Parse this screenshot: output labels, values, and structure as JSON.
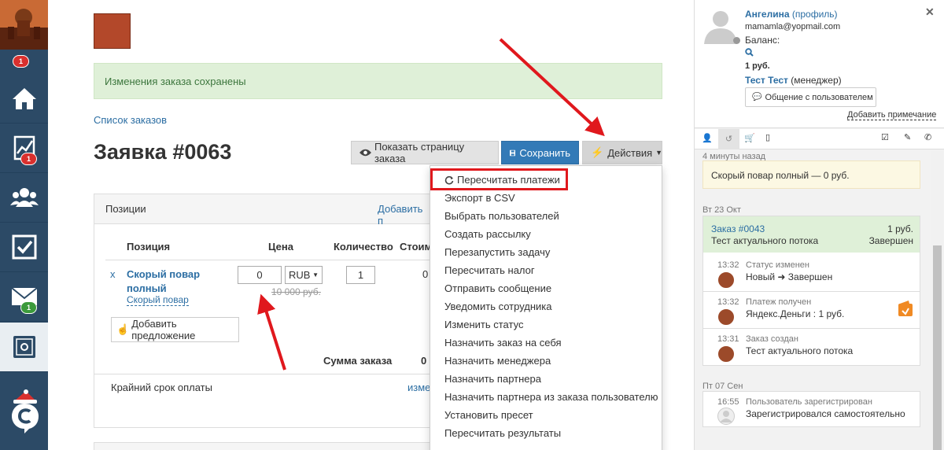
{
  "nav": {
    "orders_badge": "1",
    "stats_badge": "1",
    "mail_badge": "1"
  },
  "alert": {
    "message": "Изменения заказа сохранены"
  },
  "breadcrumb": {
    "label": "Список заказов"
  },
  "header": {
    "title": "Заявка #0063",
    "show_page_label": "Показать страницу заказа",
    "save_label": "Сохранить",
    "actions_label": "Действия"
  },
  "positions": {
    "title": "Позиции",
    "add_link": "Добавить п",
    "columns": {
      "position": "Позиция",
      "price": "Цена",
      "qty": "Количество",
      "cost": "Стоим"
    },
    "row": {
      "remove": "x",
      "name": "Скорый повар полный",
      "product_link": "Скорый повар",
      "price_value": "0",
      "currency": "RUB",
      "old_price": "10 000 руб.",
      "qty": "1",
      "cost": "0"
    },
    "add_offer": "Добавить предложение",
    "sum_label": "Сумма заказа",
    "sum_value": "0",
    "deadline_label": "Крайний срок оплаты",
    "deadline_link": "изме"
  },
  "dropdown": {
    "items": [
      "Пересчитать платежи",
      "Экспорт в CSV",
      "Выбрать пользователей",
      "Создать рассылку",
      "Перезапустить задачу",
      "Пересчитать налог",
      "Отправить сообщение",
      "Уведомить сотрудника",
      "Изменить статус",
      "Назначить заказ на себя",
      "Назначить менеджера",
      "Назначить партнера",
      "Назначить партнера из заказа пользователю",
      "Установить пресет",
      "Пересчитать результаты"
    ]
  },
  "user": {
    "name": "Ангелина",
    "profile_link": "(профиль)",
    "email": "mamamla@yopmail.com",
    "balance_label": "Баланс:",
    "balance_value": "1 руб.",
    "manager_name": "Тест Тест",
    "manager_role": "(менеджер)",
    "chat_button": "Общение с пользователем",
    "add_note": "Добавить примечание"
  },
  "feed": {
    "time_ago": "4 минуты назад",
    "recent_item": "Скорый повар полный — 0 руб.",
    "date1": "Вт 23 Окт",
    "order_title": "Заказ #0043",
    "order_amount": "1 руб.",
    "order_subtitle": "Тест актуального потока",
    "order_status": "Завершен",
    "events": [
      {
        "time": "13:32",
        "title": "Статус изменен",
        "from": "Новый",
        "to": "Завершен"
      },
      {
        "time": "13:32",
        "title": "Платеж получен",
        "text": "Яндекс.Деньги : 1 руб."
      },
      {
        "time": "13:31",
        "title": "Заказ создан",
        "text": "Тест актуального потока"
      }
    ],
    "date2": "Пт 07 Сен",
    "reg_time": "16:55",
    "reg_title": "Пользователь зарегистрирован",
    "reg_text": "Зарегистрировался самостоятельно"
  },
  "colors": {
    "accent_blue": "#337ab7",
    "highlight_red": "#e0181d",
    "nav_bg": "#2c4a66"
  }
}
